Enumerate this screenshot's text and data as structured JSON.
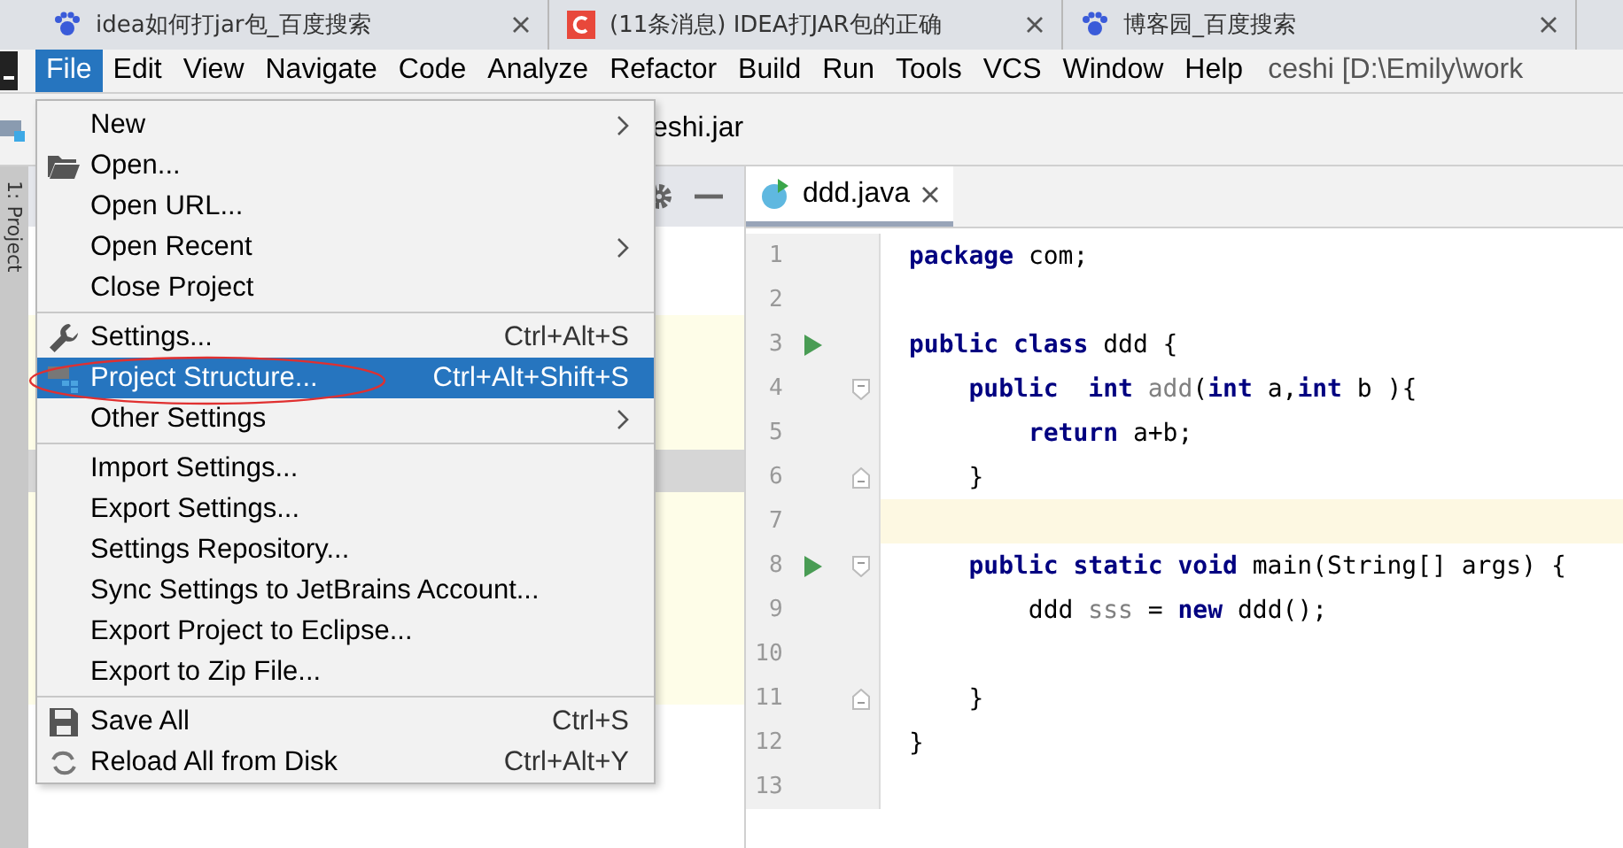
{
  "browser_tabs": [
    {
      "title": "idea如何打jar包_百度搜索"
    },
    {
      "title": "(11条消息) IDEA打JAR包的正确"
    },
    {
      "title": "博客园_百度搜索"
    }
  ],
  "menu_bar": [
    {
      "label": "File",
      "selected": true
    },
    {
      "label": "Edit",
      "selected": false
    },
    {
      "label": "View",
      "selected": false
    },
    {
      "label": "Navigate",
      "selected": false
    },
    {
      "label": "Code",
      "selected": false
    },
    {
      "label": "Analyze",
      "selected": false
    },
    {
      "label": "Refactor",
      "selected": false
    },
    {
      "label": "Build",
      "selected": false
    },
    {
      "label": "Run",
      "selected": false
    },
    {
      "label": "Tools",
      "selected": false
    },
    {
      "label": "VCS",
      "selected": false
    },
    {
      "label": "Window",
      "selected": false
    },
    {
      "label": "Help",
      "selected": false
    }
  ],
  "window_title": "ceshi [D:\\Emily\\work",
  "breadcrumb": "eshi.jar",
  "side_tab": "1: Project",
  "file_menu": [
    {
      "kind": "item",
      "label": "New",
      "submenu": true,
      "selected": false,
      "annotated": false
    },
    {
      "kind": "item",
      "label": "Open...",
      "submenu": false,
      "selected": false,
      "annotated": false
    },
    {
      "kind": "item",
      "label": "Open URL...",
      "submenu": false,
      "selected": false,
      "annotated": false
    },
    {
      "kind": "item",
      "label": "Open Recent",
      "submenu": true,
      "selected": false,
      "annotated": false
    },
    {
      "kind": "item",
      "label": "Close Project",
      "submenu": false,
      "selected": false,
      "annotated": false
    },
    {
      "kind": "separator"
    },
    {
      "kind": "item",
      "label": "Settings...",
      "shortcut": "Ctrl+Alt+S",
      "submenu": false,
      "selected": false,
      "annotated": false
    },
    {
      "kind": "item",
      "label": "Project Structure...",
      "shortcut": "Ctrl+Alt+Shift+S",
      "submenu": false,
      "selected": true,
      "annotated": true
    },
    {
      "kind": "item",
      "label": "Other Settings",
      "submenu": true,
      "selected": false,
      "annotated": false
    },
    {
      "kind": "separator"
    },
    {
      "kind": "item",
      "label": "Import Settings...",
      "submenu": false,
      "selected": false,
      "annotated": false
    },
    {
      "kind": "item",
      "label": "Export Settings...",
      "submenu": false,
      "selected": false,
      "annotated": false
    },
    {
      "kind": "item",
      "label": "Settings Repository...",
      "submenu": false,
      "selected": false,
      "annotated": false
    },
    {
      "kind": "item",
      "label": "Sync Settings to JetBrains Account...",
      "submenu": false,
      "selected": false,
      "annotated": false
    },
    {
      "kind": "item",
      "label": "Export Project to Eclipse...",
      "submenu": false,
      "selected": false,
      "annotated": false
    },
    {
      "kind": "item",
      "label": "Export to Zip File...",
      "submenu": false,
      "selected": false,
      "annotated": false
    },
    {
      "kind": "separator"
    },
    {
      "kind": "item",
      "label": "Save All",
      "shortcut": "Ctrl+S",
      "submenu": false,
      "selected": false,
      "annotated": false
    },
    {
      "kind": "item",
      "label": "Reload All from Disk",
      "shortcut": "Ctrl+Alt+Y",
      "submenu": false,
      "selected": false,
      "annotated": false
    }
  ],
  "editor_tab": {
    "title": "ddd.java",
    "selected": true
  },
  "code_lines": [
    {
      "number": "1",
      "run": false,
      "fold_open": false,
      "fold_close": false,
      "current": false,
      "tokens": [
        {
          "kind": "keyword",
          "text": "package"
        },
        {
          "kind": "plain",
          "text": " com;"
        }
      ]
    },
    {
      "number": "2",
      "run": false,
      "fold_open": false,
      "fold_close": false,
      "current": false
    },
    {
      "number": "3",
      "run": true,
      "fold_open": false,
      "fold_close": false,
      "current": false,
      "tokens": [
        {
          "kind": "keyword",
          "text": "public class"
        },
        {
          "kind": "plain",
          "text": " ddd {"
        }
      ]
    },
    {
      "number": "4",
      "run": false,
      "fold_open": true,
      "fold_close": false,
      "current": false,
      "tokens": [
        {
          "kind": "keyword",
          "text": "    public  int"
        },
        {
          "kind": "muted",
          "text": " add"
        },
        {
          "kind": "plain",
          "text": "("
        },
        {
          "kind": "keyword",
          "text": "int"
        },
        {
          "kind": "plain",
          "text": " a,"
        },
        {
          "kind": "keyword",
          "text": "int"
        },
        {
          "kind": "plain",
          "text": " b ){"
        }
      ]
    },
    {
      "number": "5",
      "run": false,
      "fold_open": false,
      "fold_close": false,
      "current": false,
      "tokens": [
        {
          "kind": "keyword",
          "text": "        return"
        },
        {
          "kind": "plain",
          "text": " a+b;"
        }
      ]
    },
    {
      "number": "6",
      "run": false,
      "fold_open": false,
      "fold_close": true,
      "current": false,
      "tokens": [
        {
          "kind": "plain",
          "text": "    }"
        }
      ]
    },
    {
      "number": "7",
      "run": false,
      "fold_open": false,
      "fold_close": false,
      "current": true
    },
    {
      "number": "8",
      "run": true,
      "fold_open": true,
      "fold_close": false,
      "current": false,
      "tokens": [
        {
          "kind": "keyword",
          "text": "    public static void"
        },
        {
          "kind": "plain",
          "text": " main(String[] args) {"
        }
      ]
    },
    {
      "number": "9",
      "run": false,
      "fold_open": false,
      "fold_close": false,
      "current": false,
      "tokens": [
        {
          "kind": "plain",
          "text": "        ddd "
        },
        {
          "kind": "muted",
          "text": "sss"
        },
        {
          "kind": "plain",
          "text": " = "
        },
        {
          "kind": "keyword",
          "text": "new"
        },
        {
          "kind": "plain",
          "text": " ddd();"
        }
      ]
    },
    {
      "number": "10",
      "run": false,
      "fold_open": false,
      "fold_close": false,
      "current": false
    },
    {
      "number": "11",
      "run": false,
      "fold_open": false,
      "fold_close": true,
      "current": false,
      "tokens": [
        {
          "kind": "plain",
          "text": "    }"
        }
      ]
    },
    {
      "number": "12",
      "run": false,
      "fold_open": false,
      "fold_close": false,
      "current": false,
      "tokens": [
        {
          "kind": "plain",
          "text": "}"
        }
      ]
    },
    {
      "number": "13",
      "run": false,
      "fold_open": false,
      "fold_close": false,
      "current": false
    }
  ]
}
